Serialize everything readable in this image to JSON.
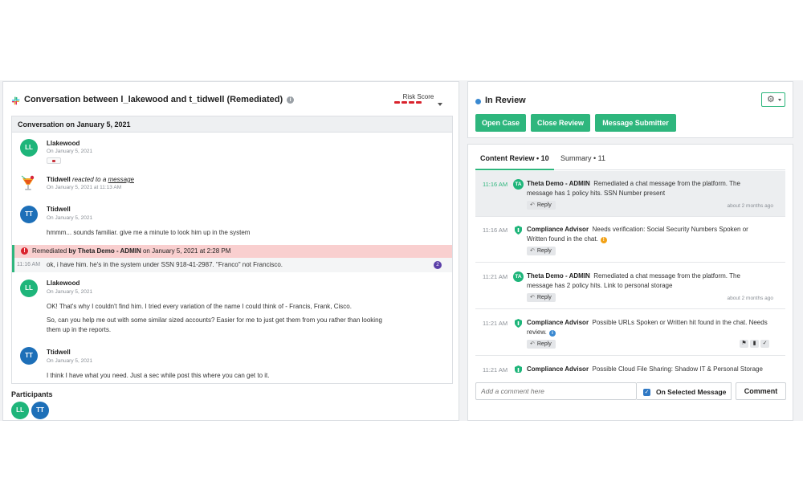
{
  "conversation": {
    "title": "Conversation between l_lakewood and t_tidwell (Remediated)",
    "risk_label": "Risk Score",
    "date_header": "Conversation on January 5, 2021",
    "messages": [
      {
        "initials": "LL",
        "name": "Llakewood",
        "date": "On January 5, 2021"
      },
      {
        "name": "Ttidwell",
        "reacted": "reacted to a",
        "link": "message",
        "date": "On January 5, 2021 at 11:13 AM"
      },
      {
        "initials": "TT",
        "name": "Ttidwell",
        "date": "On January 5, 2021",
        "text": "hmmm... sounds familiar. give me a minute to look him up in the system"
      },
      {
        "remediated_prefix": "Remediated",
        "remediated_by": "by Theta Demo - ADMIN",
        "remediated_suffix": "on January 5, 2021 at 2:28 PM",
        "time": "11:16 AM",
        "text": "ok, i have him. he's in the system under SSN 918-41-2987. \"Franco\" not Francisco.",
        "count": "2"
      },
      {
        "initials": "LL",
        "name": "Llakewood",
        "date": "On January 5, 2021",
        "text1": "OK! That's why I couldn't find him. I tried every variation of the name I could think of - Francis, Frank, Cisco.",
        "text2": "So, can you help me out with some similar sized accounts? Easier for me to just get them from you rather than looking",
        "text3": "them up in the reports."
      },
      {
        "initials": "TT",
        "name": "Ttidwell",
        "date": "On January 5, 2021",
        "text": "I think I have what you need. Just a sec while post this where you can get to it."
      }
    ],
    "participants_title": "Participants",
    "participants": [
      "LL",
      "TT"
    ]
  },
  "review": {
    "status": "In Review",
    "buttons": {
      "open_case": "Open Case",
      "close_review": "Close Review",
      "message_submitter": "Message Submitter"
    },
    "tabs": {
      "content_review": "Content Review • 10",
      "summary": "Summary • 11"
    },
    "items": [
      {
        "time": "11:16 AM",
        "badge": "TA",
        "author": "Theta Demo - ADMIN",
        "text": "Remediated a chat message from the platform. The message has 1 policy hits. SSN Number present",
        "reply": "Reply",
        "ago": "about 2 months ago"
      },
      {
        "time": "11:16 AM",
        "author": "Compliance Advisor",
        "text": "Needs verification: Social Security Numbers Spoken or Written found in the chat.",
        "reply": "Reply"
      },
      {
        "time": "11:21 AM",
        "badge": "TA",
        "author": "Theta Demo - ADMIN",
        "text": "Remediated a chat message from the platform. The message has 2 policy hits. Link to personal storage",
        "reply": "Reply",
        "ago": "about 2 months ago"
      },
      {
        "time": "11:21 AM",
        "author": "Compliance Advisor",
        "text": "Possible URLs Spoken or Written hit found in the chat. Needs review.",
        "reply": "Reply"
      },
      {
        "time": "11:21 AM",
        "author": "Compliance Advisor",
        "text": "Possible Cloud File Sharing: Shadow IT & Personal Storage"
      }
    ],
    "comment_placeholder": "Add a comment here",
    "on_selected_label": "On Selected Message",
    "comment_button": "Comment"
  },
  "colors": {
    "accent": "#2eb67d",
    "remediated_bg": "#f9cfcf",
    "risk": "#d9232d",
    "avatar_ll": "#1eb57a",
    "avatar_tt": "#1d6fb8"
  }
}
